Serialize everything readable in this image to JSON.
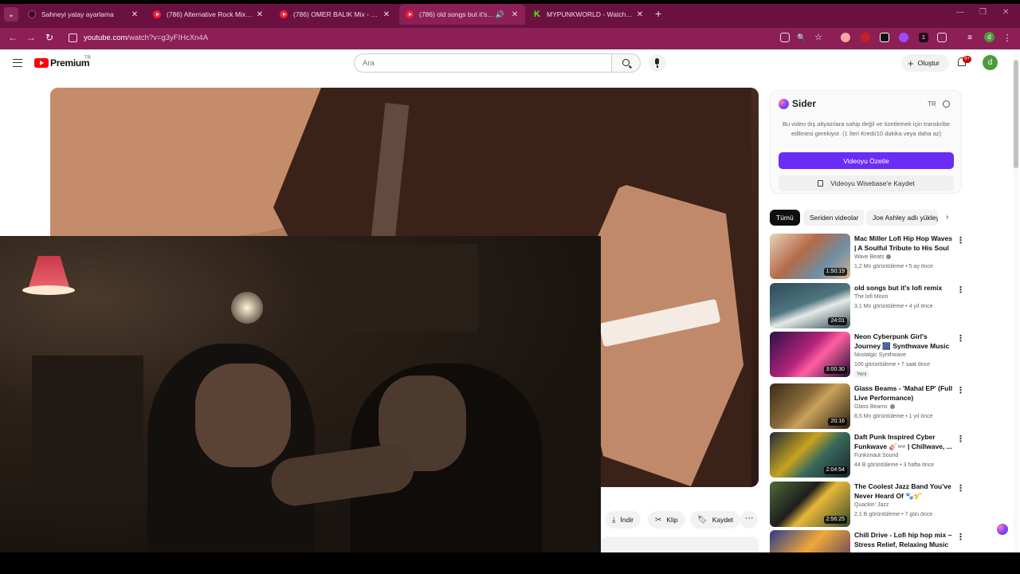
{
  "browser": {
    "tabs": [
      {
        "title": "Sahneyi yatay ayarlama",
        "active": false
      },
      {
        "title": "(786) Alternative Rock Mix Playlist",
        "active": false
      },
      {
        "title": "(786) OMER BALIK Mix - Best of",
        "active": false
      },
      {
        "title": "(786) old songs but it's lofi remix",
        "active": true
      },
      {
        "title": "MYPUNKWORLD - Watch clips",
        "active": false
      }
    ],
    "url_host": "youtube.com",
    "url_path": "/watch?v=g3yFIHcXn4A",
    "ext_badge": "1",
    "profile_initial": "d"
  },
  "header": {
    "brand": "Premium",
    "country": "TR",
    "search_placeholder": "Ara",
    "create_label": "Oluştur",
    "notif_count": "9+",
    "avatar_initial": "d"
  },
  "actions": {
    "download": "İndir",
    "clip": "Klip",
    "save": "Kaydet"
  },
  "sider": {
    "name": "Sider",
    "lang": "TR",
    "message": "Bu video dış altyazılara sahip değil ve özetlemek için transkribe edilmesi gerekiyor. (1 İleri Kredi/10 dakika veya daha az)",
    "summarize": "Videoyu Özetle",
    "save_wisebase": "Videoyu Wisebase'e Kaydet"
  },
  "chips": [
    "Tümü",
    "Seriden videolar",
    "Joe Ashley adlı yükleyiciden"
  ],
  "recommendations": [
    {
      "title": "Mac Miller Lofi Hip Hop Waves | A Soulful Tribute to His Soul 🪐",
      "channel": "Wave Beats",
      "meta": "1,2 Mn görüntüleme • 5 ay önce",
      "duration": "1:50:19",
      "verified": true
    },
    {
      "title": "old songs but it's lofi remix",
      "channel": "The lofi Moon",
      "meta": "3,1 Mn görüntüleme • 4 yıl önce",
      "duration": "24:01",
      "verified": false
    },
    {
      "title": "Neon Cyberpunk Girl's Journey 🎆 Synthwave Music for ...",
      "channel": "Nostalgic Synthwave",
      "meta": "100 görüntüleme • 7 saat önce",
      "duration": "3:00:30",
      "verified": false,
      "badge": "Yeni"
    },
    {
      "title": "Glass Beams - 'Mahal EP' (Full Live Performance)",
      "channel": "Glass Beams",
      "meta": "8,5 Mn görüntüleme • 1 yıl önce",
      "duration": "20:16",
      "verified": true
    },
    {
      "title": "Daft Punk Inspired Cyber Funkwave 🎸👓 | Chillwave, ...",
      "channel": "Funkonaut Sound",
      "meta": "44 B görüntüleme • 3 hafta önce",
      "duration": "2:04:54",
      "verified": false
    },
    {
      "title": "The Coolest Jazz Band You've Never Heard Of 🐾🎷",
      "channel": "Quackin' Jazz",
      "meta": "2,1 B görüntüleme • 7 gün önce",
      "duration": "2:56:25",
      "verified": false
    },
    {
      "title": "Chill Drive - Lofi hip hop mix ~ Stress Relief, Relaxing Music",
      "channel": "",
      "meta": "",
      "duration": "",
      "verified": false
    }
  ]
}
